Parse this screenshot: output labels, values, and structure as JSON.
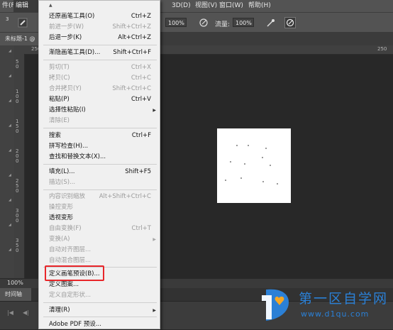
{
  "colors": {
    "chrome": "#535353",
    "workspace": "#282828",
    "menu_bg": "#f0f0f0",
    "highlight_box": "#e8262a",
    "watermark": "#2b80d6"
  },
  "menubar": {
    "file_partial": "件(F)",
    "edit": "编辑(E)",
    "three_d": "3D(D)",
    "view": "视图(V)",
    "window": "窗口(W)",
    "help": "帮助(H)"
  },
  "options_bar": {
    "brush_size": "3",
    "opacity_value": "100%",
    "flow_label": "流量:",
    "flow_value": "100%"
  },
  "document": {
    "tab_title": "未标题-1 @"
  },
  "ruler": {
    "top_left": "250",
    "top_right": "250",
    "left_marks": [
      "50",
      "100",
      "150",
      "200",
      "250",
      "300",
      "350"
    ]
  },
  "status": {
    "zoom": "100%"
  },
  "timeline": {
    "tab_label": "时间轴"
  },
  "edit_menu": {
    "items": [
      {
        "label": "还原画笔工具(O)",
        "shortcut": "Ctrl+Z",
        "enabled": true
      },
      {
        "label": "前进一步(W)",
        "shortcut": "Shift+Ctrl+Z",
        "enabled": false
      },
      {
        "label": "后退一步(K)",
        "shortcut": "Alt+Ctrl+Z",
        "enabled": true
      },
      {
        "label": "渐隐画笔工具(D)...",
        "shortcut": "Shift+Ctrl+F",
        "enabled": true
      },
      {
        "label": "剪切(T)",
        "shortcut": "Ctrl+X",
        "enabled": false
      },
      {
        "label": "拷贝(C)",
        "shortcut": "Ctrl+C",
        "enabled": false
      },
      {
        "label": "合并拷贝(Y)",
        "shortcut": "Shift+Ctrl+C",
        "enabled": false
      },
      {
        "label": "粘贴(P)",
        "shortcut": "Ctrl+V",
        "enabled": true
      },
      {
        "label": "选择性粘贴(I)",
        "shortcut": "",
        "enabled": true
      },
      {
        "label": "清除(E)",
        "shortcut": "",
        "enabled": false
      },
      {
        "label": "搜索",
        "shortcut": "Ctrl+F",
        "enabled": true
      },
      {
        "label": "拼写检查(H)...",
        "shortcut": "",
        "enabled": true
      },
      {
        "label": "查找和替换文本(X)...",
        "shortcut": "",
        "enabled": true
      },
      {
        "label": "填充(L)...",
        "shortcut": "Shift+F5",
        "enabled": true
      },
      {
        "label": "描边(S)...",
        "shortcut": "",
        "enabled": false
      },
      {
        "label": "内容识别缩放",
        "shortcut": "Alt+Shift+Ctrl+C",
        "enabled": false
      },
      {
        "label": "操控变形",
        "shortcut": "",
        "enabled": false
      },
      {
        "label": "透视变形",
        "shortcut": "",
        "enabled": true
      },
      {
        "label": "自由变换(F)",
        "shortcut": "Ctrl+T",
        "enabled": false
      },
      {
        "label": "变换(A)",
        "shortcut": "",
        "enabled": false
      },
      {
        "label": "自动对齐图层...",
        "shortcut": "",
        "enabled": false
      },
      {
        "label": "自动混合图层...",
        "shortcut": "",
        "enabled": false
      },
      {
        "label": "定义画笔预设(B)...",
        "shortcut": "",
        "enabled": true
      },
      {
        "label": "定义图案...",
        "shortcut": "",
        "enabled": true
      },
      {
        "label": "定义自定形状...",
        "shortcut": "",
        "enabled": false
      },
      {
        "label": "清理(R)",
        "shortcut": "",
        "enabled": true
      },
      {
        "label": "Adobe PDF 预设...",
        "shortcut": "",
        "enabled": true
      }
    ]
  },
  "watermark": {
    "title": "第一区自学网",
    "url": "www.d1qu.com"
  }
}
